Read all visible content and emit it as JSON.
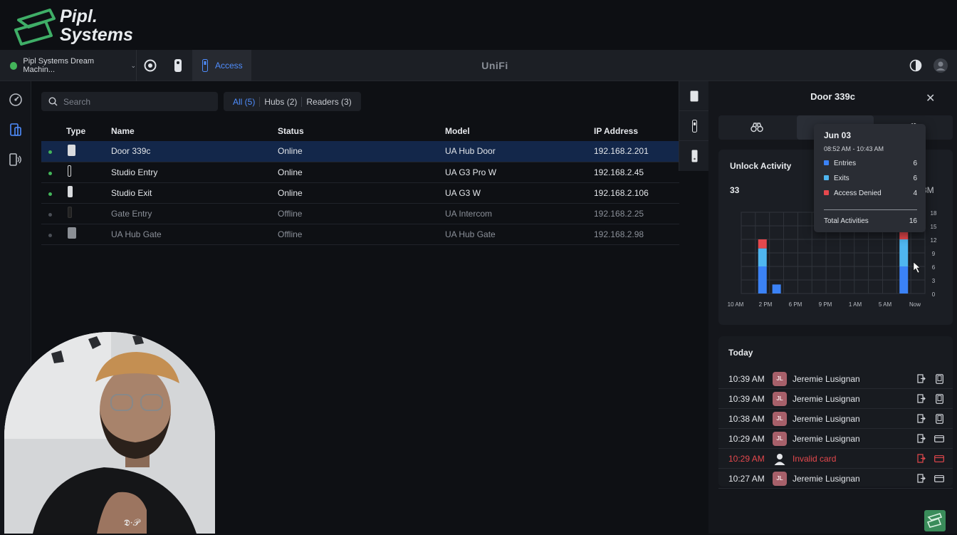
{
  "brand": {
    "line1": "Pipl.",
    "line2": "Systems"
  },
  "topbar": {
    "site": "Pipl Systems Dream Machin...",
    "access_tab": "Access",
    "center_title": "UniFi"
  },
  "search": {
    "placeholder": "Search"
  },
  "filters": [
    {
      "label": "All (5)",
      "active": true
    },
    {
      "label": "Hubs (2)",
      "active": false
    },
    {
      "label": "Readers (3)",
      "active": false
    }
  ],
  "table": {
    "headers": [
      "Type",
      "Name",
      "Status",
      "Model",
      "IP Address"
    ],
    "rows": [
      {
        "name": "Door 339c",
        "status": "Online",
        "model": "UA Hub Door",
        "ip": "192.168.2.201",
        "online": true,
        "selected": true
      },
      {
        "name": "Studio Entry",
        "status": "Online",
        "model": "UA G3 Pro W",
        "ip": "192.168.2.45",
        "online": true,
        "selected": false
      },
      {
        "name": "Studio Exit",
        "status": "Online",
        "model": "UA G3 W",
        "ip": "192.168.2.106",
        "online": true,
        "selected": false
      },
      {
        "name": "Gate Entry",
        "status": "Offline",
        "model": "UA Intercom",
        "ip": "192.168.2.25",
        "online": false,
        "selected": false
      },
      {
        "name": "UA Hub Gate",
        "status": "Offline",
        "model": "UA Hub Gate",
        "ip": "192.168.2.98",
        "online": false,
        "selected": false
      }
    ]
  },
  "panel": {
    "title": "Door 339c",
    "unlock_title": "Unlock Activity",
    "total": "33",
    "range_partial": "3M",
    "today_title": "Today"
  },
  "chart_data": {
    "type": "bar",
    "x_tick_labels": [
      "10 AM",
      "2 PM",
      "6 PM",
      "9 PM",
      "1 AM",
      "5 AM",
      "Now"
    ],
    "y_tick_labels": [
      "18",
      "15",
      "12",
      "9",
      "6",
      "3",
      "0"
    ],
    "ylim": [
      0,
      18
    ],
    "bars": [
      {
        "slot": 2,
        "entries": 6,
        "exits": 4,
        "denied": 2
      },
      {
        "slot": 3,
        "entries": 2,
        "exits": 0,
        "denied": 0
      },
      {
        "slot": 12,
        "entries": 6,
        "exits": 6,
        "denied": 2
      }
    ],
    "colors": {
      "entries": "#3b82f6",
      "exits": "#4fb6f0",
      "denied": "#e5484d"
    }
  },
  "tooltip": {
    "date": "Jun 03",
    "time_range": "08:52 AM - 10:43 AM",
    "rows": [
      {
        "label": "Entries",
        "value": "6",
        "color": "#3b82f6"
      },
      {
        "label": "Exits",
        "value": "6",
        "color": "#4fb6f0"
      },
      {
        "label": "Access Denied",
        "value": "4",
        "color": "#e5484d"
      }
    ],
    "total_label": "Total Activities",
    "total_value": "16"
  },
  "activity": [
    {
      "time": "10:39 AM",
      "initials": "JL",
      "name": "Jeremie Lusignan",
      "denied": false,
      "method": "phone"
    },
    {
      "time": "10:39 AM",
      "initials": "JL",
      "name": "Jeremie Lusignan",
      "denied": false,
      "method": "phone"
    },
    {
      "time": "10:38 AM",
      "initials": "JL",
      "name": "Jeremie Lusignan",
      "denied": false,
      "method": "phone"
    },
    {
      "time": "10:29 AM",
      "initials": "JL",
      "name": "Jeremie Lusignan",
      "denied": false,
      "method": "card"
    },
    {
      "time": "10:29 AM",
      "initials": "",
      "name": "Invalid card",
      "denied": true,
      "method": "card"
    },
    {
      "time": "10:27 AM",
      "initials": "JL",
      "name": "Jeremie Lusignan",
      "denied": false,
      "method": "card"
    }
  ],
  "webcam": {
    "shirt_text": "𝕯·𝒫"
  },
  "colors": {
    "accent": "#4f8dfd",
    "online": "#43b55a",
    "denied": "#e5484d",
    "selected_row": "#13274a"
  }
}
